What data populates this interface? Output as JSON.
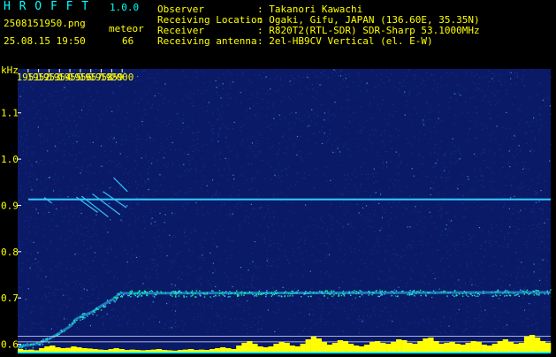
{
  "header": {
    "app_name": "H R O F F T",
    "version": "1.0.0",
    "filename": "2508151950.png",
    "datetime": "25.08.15 19:50",
    "meteor_label": "meteor",
    "meteor_count": "66",
    "fields": [
      {
        "label": "Observer",
        "value": ": Takanori Kawachi"
      },
      {
        "label": "Receiving Location",
        "value": ": Ogaki, Gifu, JAPAN (136.60E, 35.35N)"
      },
      {
        "label": "Receiver",
        "value": ": R820T2(RTL-SDR) SDR-Sharp 53.1000MHz"
      },
      {
        "label": "Receiving antenna",
        "value": ": 2el-HB9CV Vertical (el. E-W)"
      }
    ]
  },
  "colors": {
    "header_text": "#ffff00",
    "header_accent": "#00ffff",
    "tick_text": "#ffff00",
    "noise_dark": "#0a1a66",
    "noise_mid": "#1f3fb0",
    "noise_bright": "#40a0ff",
    "signal_main": "#33ccff",
    "signal_hot": "#00ff88",
    "energy_bar": "#ffff00",
    "energy_base": "#00ffff"
  },
  "chart_data": {
    "type": "heatmap",
    "ylabel": "kHz",
    "x_tick_labels": [
      "1951",
      "1952",
      "1953",
      "1954",
      "1955",
      "1956",
      "1957",
      "1958",
      "1959",
      "2000"
    ],
    "y_tick_labels": [
      "1.1",
      "1.0",
      "0.9",
      "0.8",
      "0.7",
      "0.6"
    ],
    "y_ticks": [
      1.1,
      1.0,
      0.9,
      0.8,
      0.7,
      0.6
    ],
    "x_range_min": [
      1950,
      2000
    ],
    "y_range_khz": [
      0.58,
      1.195
    ],
    "carrier_line": {
      "freq_khz": 0.913,
      "x_start_min": 1951.0,
      "x_end_min": 2000.0
    },
    "meteor_streaks": [
      {
        "x0": 1955.5,
        "y0": 0.918,
        "x1": 1957.5,
        "y1": 0.885
      },
      {
        "x0": 1956.0,
        "y0": 0.92,
        "x1": 1958.5,
        "y1": 0.875
      },
      {
        "x0": 1957.0,
        "y0": 0.925,
        "x1": 1959.6,
        "y1": 0.88
      },
      {
        "x0": 1958.0,
        "y0": 0.93,
        "x1": 1960.2,
        "y1": 0.895
      },
      {
        "x0": 1959.0,
        "y0": 0.96,
        "x1": 1960.3,
        "y1": 0.93
      },
      {
        "x0": 1952.5,
        "y0": 0.917,
        "x1": 1953.2,
        "y1": 0.905
      }
    ],
    "drift_band": [
      {
        "x": 1950.0,
        "y": 0.595
      },
      {
        "x": 1951.0,
        "y": 0.598
      },
      {
        "x": 1952.0,
        "y": 0.602
      },
      {
        "x": 1953.0,
        "y": 0.612
      },
      {
        "x": 1954.0,
        "y": 0.625
      },
      {
        "x": 1955.0,
        "y": 0.64
      },
      {
        "x": 1955.5,
        "y": 0.655
      },
      {
        "x": 1956.0,
        "y": 0.66
      },
      {
        "x": 1957.0,
        "y": 0.67
      },
      {
        "x": 1958.0,
        "y": 0.685
      },
      {
        "x": 1959.0,
        "y": 0.698
      },
      {
        "x": 1959.6,
        "y": 0.71
      },
      {
        "x": 2000.0,
        "y": 0.712
      }
    ],
    "reference_lines_khz": [
      0.617,
      0.605
    ],
    "energy_profile": [
      0.15,
      0.1,
      0.12,
      0.08,
      0.2,
      0.3,
      0.35,
      0.25,
      0.2,
      0.22,
      0.3,
      0.25,
      0.2,
      0.18,
      0.15,
      0.12,
      0.1,
      0.15,
      0.2,
      0.15,
      0.1,
      0.12,
      0.1,
      0.08,
      0.1,
      0.12,
      0.15,
      0.1,
      0.08,
      0.06,
      0.1,
      0.12,
      0.15,
      0.1,
      0.12,
      0.1,
      0.15,
      0.2,
      0.25,
      0.2,
      0.15,
      0.35,
      0.5,
      0.6,
      0.45,
      0.3,
      0.25,
      0.3,
      0.45,
      0.55,
      0.5,
      0.35,
      0.3,
      0.45,
      0.7,
      0.85,
      0.75,
      0.55,
      0.4,
      0.5,
      0.65,
      0.6,
      0.45,
      0.35,
      0.3,
      0.4,
      0.55,
      0.6,
      0.5,
      0.45,
      0.55,
      0.7,
      0.65,
      0.5,
      0.45,
      0.6,
      0.75,
      0.8,
      0.6,
      0.45,
      0.5,
      0.55,
      0.45,
      0.4,
      0.5,
      0.6,
      0.55,
      0.4,
      0.35,
      0.45,
      0.6,
      0.7,
      0.55,
      0.45,
      0.5,
      0.85,
      0.95,
      0.8,
      0.6,
      0.5
    ]
  }
}
